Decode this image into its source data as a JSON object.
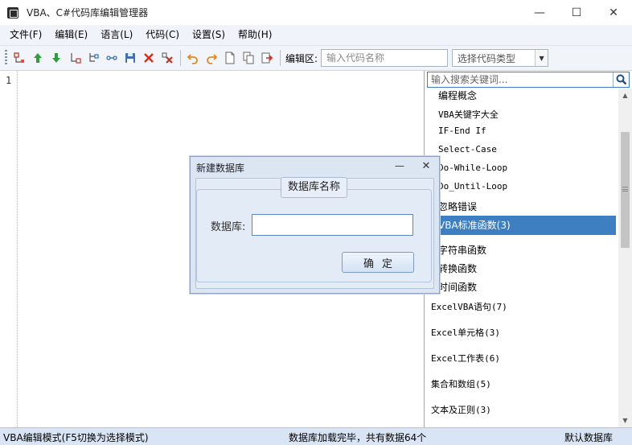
{
  "window": {
    "title": "VBA、C#代码库编辑管理器",
    "minimize_glyph": "—",
    "maximize_glyph": "☐",
    "close_glyph": "✕"
  },
  "menu": [
    {
      "label": "文件(F)"
    },
    {
      "label": "编辑(E)"
    },
    {
      "label": "语言(L)"
    },
    {
      "label": "代码(C)"
    },
    {
      "label": "设置(S)"
    },
    {
      "label": "帮助(H)"
    }
  ],
  "toolbar": {
    "edit_area_label": "编辑区:",
    "code_name_placeholder": "输入代码名称",
    "code_type_placeholder": "选择代码类型",
    "icons": [
      "new-node-icon",
      "move-up-icon",
      "move-down-icon",
      "add-child-icon",
      "add-sibling-icon",
      "link-icon",
      "save-db-icon",
      "delete-node-icon",
      "delete-all-icon",
      "undo-icon",
      "redo-icon",
      "new-file-icon",
      "copy-icon",
      "export-icon"
    ]
  },
  "editor": {
    "line_numbers": [
      "1"
    ]
  },
  "tree_panel": {
    "search_placeholder": "输入搜索关键词...",
    "items": [
      {
        "label": "编程概念"
      },
      {
        "label": "VBA关键字大全"
      },
      {
        "label": "IF-End If"
      },
      {
        "label": "Select-Case"
      },
      {
        "label": "Do-While-Loop"
      },
      {
        "label": "Do_Until-Loop"
      },
      {
        "label": "忽略错误"
      },
      {
        "label": "VBA标准函数(3)",
        "selected": true
      },
      {
        "label": "字符串函数"
      },
      {
        "label": "转换函数"
      },
      {
        "label": "时间函数"
      },
      {
        "label": "ExcelVBA语句(7)"
      },
      {
        "label": "Excel单元格(3)"
      },
      {
        "label": "Excel工作表(6)"
      },
      {
        "label": "集合和数组(5)"
      },
      {
        "label": "文本及正则(3)"
      }
    ]
  },
  "dialog": {
    "title": "新建数据库",
    "group_label": "数据库名称",
    "db_label": "数据库:",
    "db_value": "",
    "ok_label": "确定"
  },
  "status": {
    "mode": "VBA编辑模式(F5切换为选择模式)",
    "message": "数据库加载完毕，共有数据64个",
    "db": "默认数据库"
  },
  "colors": {
    "accent": "#3d7fc1",
    "toolbar_bg": "#f1f4f9",
    "status_bg": "#d9e5f5",
    "dialog_bg": "#dce6f2"
  }
}
